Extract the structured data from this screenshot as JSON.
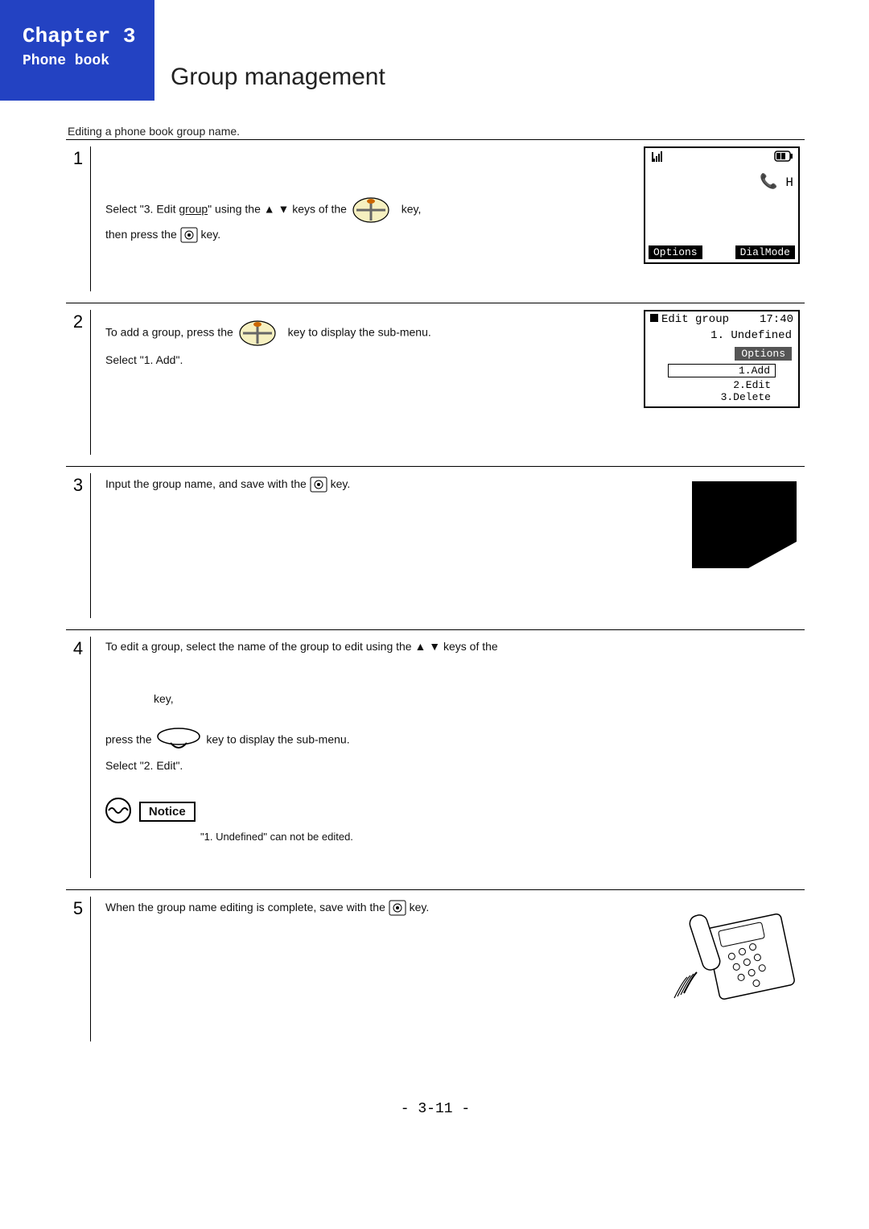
{
  "header": {
    "chapter": "Chapter 3",
    "subtitle": "Phone book",
    "page_title": "Group management"
  },
  "intro": "Editing a phone book group name.",
  "steps": {
    "s1": {
      "num": "1",
      "t1": "Select \"3. Edit ",
      "group": "group",
      "t2": "\" using the ",
      "t3": " keys of the ",
      "t4": " key,",
      "t5": "then press the ",
      "t6": " key."
    },
    "s2": {
      "num": "2",
      "t1": "To add a group, press the ",
      "t2": " key to display the sub-menu.",
      "t3": "Select \"1. Add\"."
    },
    "s3": {
      "num": "3",
      "t1": "Input the group name, and save with the ",
      "t2": " key."
    },
    "s4": {
      "num": "4",
      "t1": "To edit a group, select the name of the group to edit using the ",
      "t2": " keys of the",
      "t3": "key,",
      "t4": "press the ",
      "t5": " key to display the sub-menu.",
      "t6": "Select \"2. Edit\"."
    },
    "s5": {
      "num": "5",
      "t1": "When the group name editing is complete, save with the ",
      "t2": " key."
    },
    "notice": {
      "label": "Notice",
      "text": "\"1. Undefined\" can not be edited."
    }
  },
  "lcd1": {
    "ch": "H",
    "opt": "Options",
    "dial": "DialMode"
  },
  "lcd2": {
    "title": "Edit group",
    "time": "17:40",
    "line1": "1. Undefined",
    "options": "Options",
    "i1": "1.Add",
    "i2": "2.Edit",
    "i3": "3.Delete"
  },
  "footer": {
    "page": "- 3-11 -"
  }
}
